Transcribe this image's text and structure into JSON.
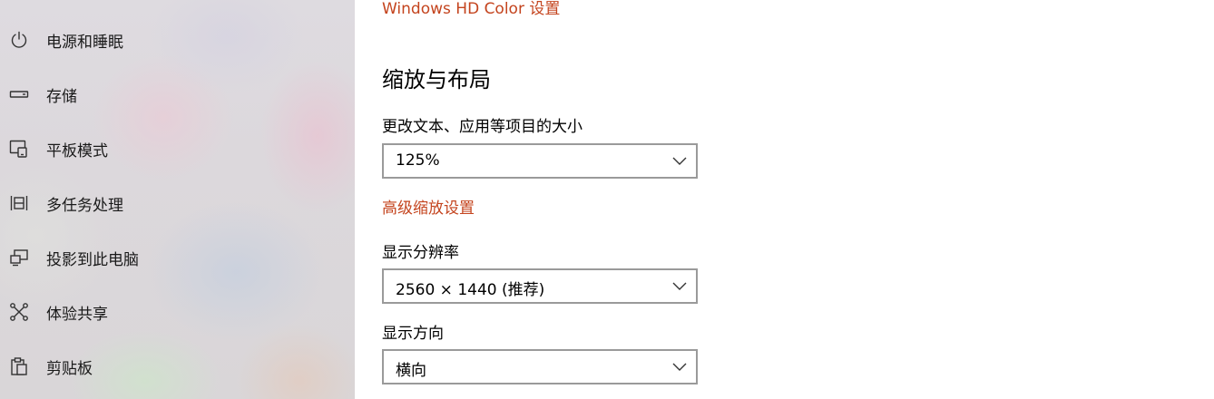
{
  "sidebar": {
    "items": [
      {
        "label": "电源和睡眠",
        "icon": "power-icon"
      },
      {
        "label": "存储",
        "icon": "storage-icon"
      },
      {
        "label": "平板模式",
        "icon": "tablet-mode-icon"
      },
      {
        "label": "多任务处理",
        "icon": "multitasking-icon"
      },
      {
        "label": "投影到此电脑",
        "icon": "project-icon"
      },
      {
        "label": "体验共享",
        "icon": "shared-experiences-icon"
      },
      {
        "label": "剪贴板",
        "icon": "clipboard-icon"
      }
    ]
  },
  "main": {
    "hd_color_link": "Windows HD Color 设置",
    "scale_section": {
      "title": "缩放与布局",
      "text_size_label": "更改文本、应用等项目的大小",
      "text_size_value": "125%",
      "advanced_link": "高级缩放设置",
      "resolution_label": "显示分辨率",
      "resolution_value": "2560 × 1440 (推荐)",
      "orientation_label": "显示方向",
      "orientation_value": "横向"
    }
  },
  "colors": {
    "link": "#c4441e",
    "dropdown_border": "#9a9a9a"
  }
}
